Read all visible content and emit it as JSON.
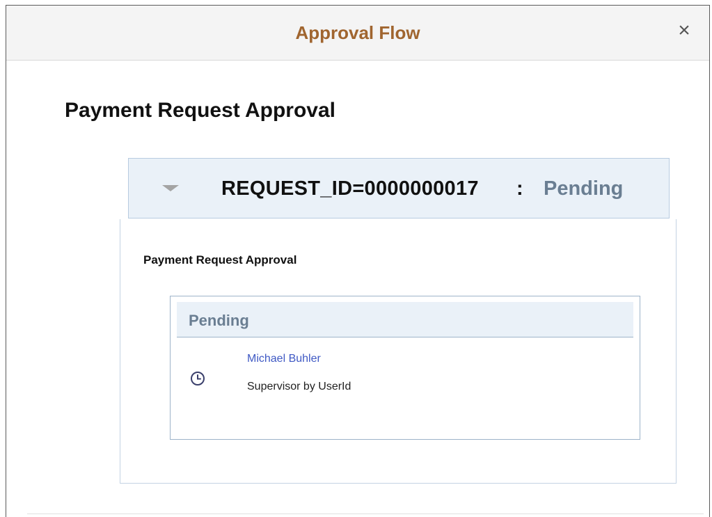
{
  "modal": {
    "title": "Approval Flow",
    "close_label": "×"
  },
  "page": {
    "title": "Payment Request Approval"
  },
  "group": {
    "request_label": "REQUEST_ID=0000000017",
    "separator": ":",
    "status": "Pending",
    "toggle_icon": "triangle-down-icon"
  },
  "flow": {
    "title": "Payment Request Approval",
    "stage": {
      "status": "Pending",
      "approver": {
        "name": "Michael Buhler",
        "role": "Supervisor by UserId",
        "icon": "clock-icon"
      }
    }
  }
}
